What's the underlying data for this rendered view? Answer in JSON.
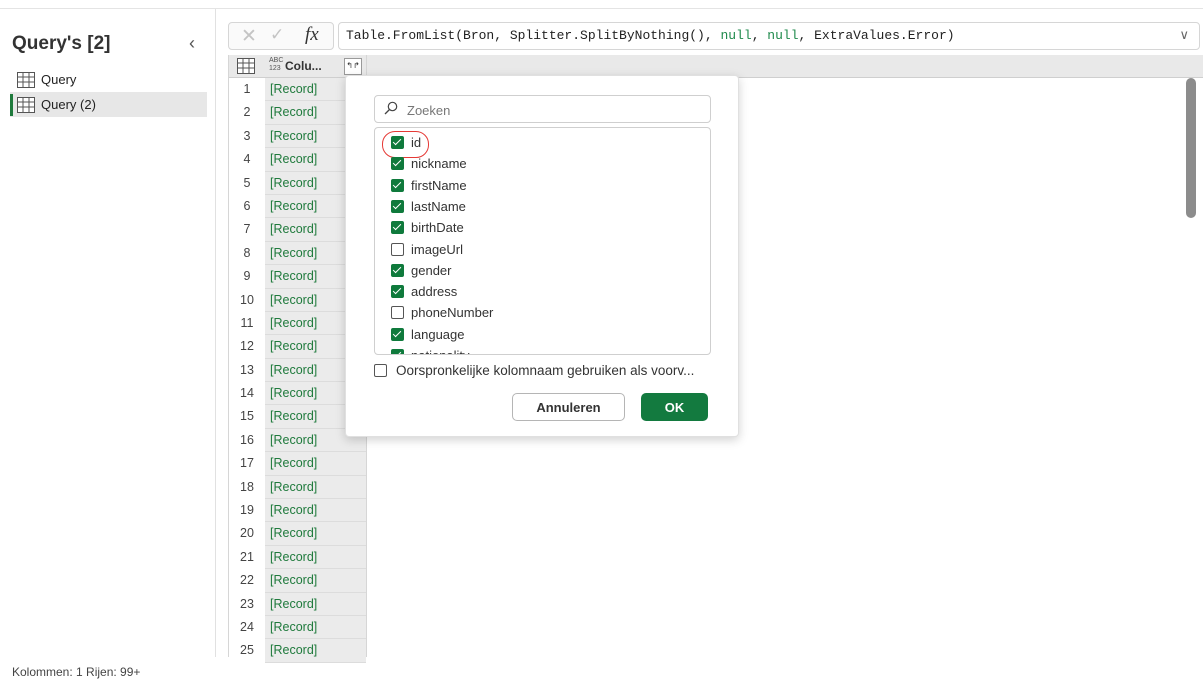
{
  "queries_pane": {
    "title": "Query's [2]",
    "collapse_icon": "chevron-left-icon",
    "items": [
      {
        "label": "Query",
        "selected": false
      },
      {
        "label": "Query (2)",
        "selected": true
      }
    ]
  },
  "formula_bar": {
    "cancel_icon": "x-icon",
    "confirm_icon": "check-icon",
    "fx_label": "fx",
    "formula_prefix": "Table.FromList(Bron, Splitter.SplitByNothing(), ",
    "null1": "null",
    "sep": ", ",
    "null2": "null",
    "formula_suffix": ", ExtraValues.Error)",
    "expand_icon": "chevron-down-icon"
  },
  "grid": {
    "column_type_top": "ABC",
    "column_type_bottom": "123",
    "column_name": "Colu...",
    "expand_icon": "expand-column-icon",
    "rows": [
      {
        "n": "1",
        "v": "[Record]"
      },
      {
        "n": "2",
        "v": "[Record]"
      },
      {
        "n": "3",
        "v": "[Record]"
      },
      {
        "n": "4",
        "v": "[Record]"
      },
      {
        "n": "5",
        "v": "[Record]"
      },
      {
        "n": "6",
        "v": "[Record]"
      },
      {
        "n": "7",
        "v": "[Record]"
      },
      {
        "n": "8",
        "v": "[Record]"
      },
      {
        "n": "9",
        "v": "[Record]"
      },
      {
        "n": "10",
        "v": "[Record]"
      },
      {
        "n": "11",
        "v": "[Record]"
      },
      {
        "n": "12",
        "v": "[Record]"
      },
      {
        "n": "13",
        "v": "[Record]"
      },
      {
        "n": "14",
        "v": "[Record]"
      },
      {
        "n": "15",
        "v": "[Record]"
      },
      {
        "n": "16",
        "v": "[Record]"
      },
      {
        "n": "17",
        "v": "[Record]"
      },
      {
        "n": "18",
        "v": "[Record]"
      },
      {
        "n": "19",
        "v": "[Record]"
      },
      {
        "n": "20",
        "v": "[Record]"
      },
      {
        "n": "21",
        "v": "[Record]"
      },
      {
        "n": "22",
        "v": "[Record]"
      },
      {
        "n": "23",
        "v": "[Record]"
      },
      {
        "n": "24",
        "v": "[Record]"
      },
      {
        "n": "25",
        "v": "[Record]"
      }
    ]
  },
  "expand_popup": {
    "search_placeholder": "Zoeken",
    "columns": [
      {
        "label": "id",
        "checked": true
      },
      {
        "label": "nickname",
        "checked": true
      },
      {
        "label": "firstName",
        "checked": true
      },
      {
        "label": "lastName",
        "checked": true
      },
      {
        "label": "birthDate",
        "checked": true
      },
      {
        "label": "imageUrl",
        "checked": false
      },
      {
        "label": "gender",
        "checked": true
      },
      {
        "label": "address",
        "checked": true
      },
      {
        "label": "phoneNumber",
        "checked": false
      },
      {
        "label": "language",
        "checked": true
      },
      {
        "label": "nationality",
        "checked": true
      }
    ],
    "use_original_name_label": "Oorspronkelijke kolomnaam gebruiken als voorv...",
    "use_original_name_checked": false,
    "cancel_label": "Annuleren",
    "ok_label": "OK"
  },
  "status_bar": {
    "text": "Kolommen: 1  Rijen: 99+"
  },
  "colors": {
    "accent_green": "#137a3f",
    "record_green": "#1f7a3c",
    "highlight_red": "#e53935"
  }
}
